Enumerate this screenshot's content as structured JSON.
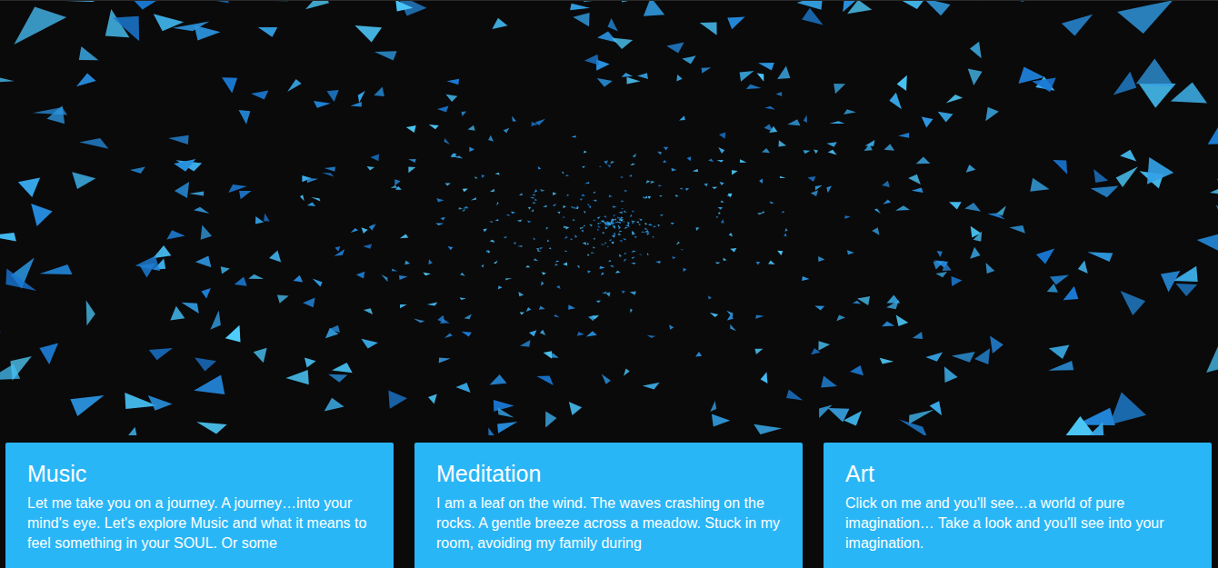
{
  "cards": [
    {
      "title": "Music",
      "text": "Let me take you on a journey. A journey…into your mind's eye. Let's explore Music and what it means to feel something in your SOUL. Or some"
    },
    {
      "title": "Meditation",
      "text": "I am a leaf on the wind. The waves crashing on the rocks. A gentle breeze across a meadow. Stuck in my room, avoiding my family during"
    },
    {
      "title": "Art",
      "text": "Click on me and you'll see…a world of pure imagination… Take a look and you'll see into your imagination."
    }
  ]
}
